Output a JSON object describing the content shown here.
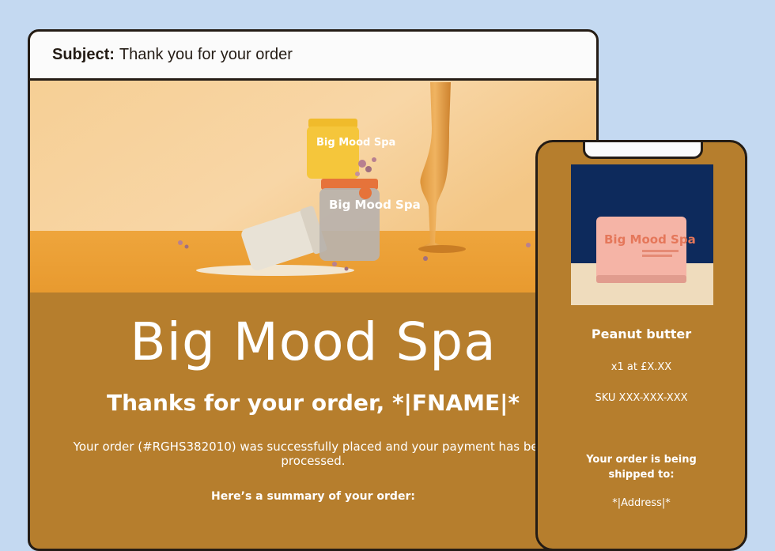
{
  "email": {
    "subject_label": "Subject:",
    "subject_text": "Thank you for your order",
    "brand_name": "Big Mood Spa",
    "thanks_heading": "Thanks for your order, *|FNAME|*",
    "message": "Your order (#RGHS382010) was successfully placed and your payment has been processed.",
    "summary_heading": "Here’s a summary of your order:",
    "jar_label_top": "Big Mood Spa",
    "jar_label_front": "Big Mood Spa"
  },
  "mobile": {
    "product_name": "Peanut butter",
    "quantity_price": "x1 at £X.XX",
    "sku": "SKU XXX-XXX-XXX",
    "shipping_label": "Your order is being shipped to:",
    "address": "*|Address|*",
    "card_label": "Big Mood Spa"
  },
  "colors": {
    "background": "#c4d9f1",
    "email_body": "#b67e2d",
    "outline": "#241c15",
    "hero_orange": "#e9a23b",
    "phone_navy": "#0d2a5c"
  }
}
